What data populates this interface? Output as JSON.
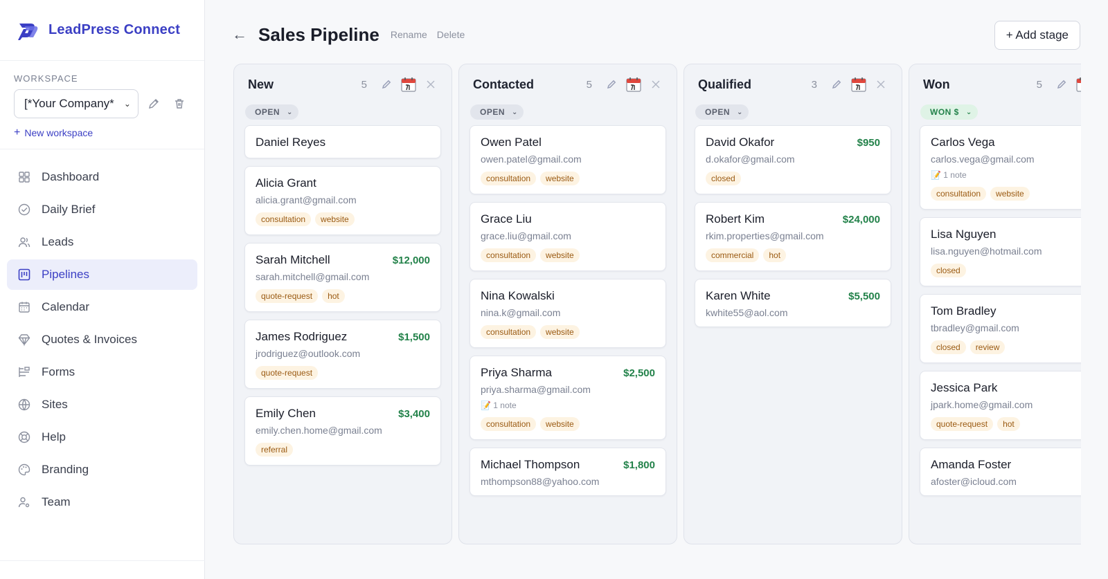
{
  "brand": {
    "name": "LeadPress Connect"
  },
  "workspace": {
    "label": "WORKSPACE",
    "selected": "[*Your Company*",
    "new_label": "New workspace"
  },
  "nav": [
    {
      "label": "Dashboard",
      "icon": "grid-icon",
      "active": false
    },
    {
      "label": "Daily Brief",
      "icon": "check-circle-icon",
      "active": false
    },
    {
      "label": "Leads",
      "icon": "users-icon",
      "active": false
    },
    {
      "label": "Pipelines",
      "icon": "kanban-icon",
      "active": true
    },
    {
      "label": "Calendar",
      "icon": "calendar-icon",
      "active": false
    },
    {
      "label": "Quotes & Invoices",
      "icon": "diamond-icon",
      "active": false
    },
    {
      "label": "Forms",
      "icon": "form-icon",
      "active": false
    },
    {
      "label": "Sites",
      "icon": "globe-icon",
      "active": false
    },
    {
      "label": "Help",
      "icon": "lifebuoy-icon",
      "active": false
    },
    {
      "label": "Branding",
      "icon": "palette-icon",
      "active": false
    },
    {
      "label": "Team",
      "icon": "user-gear-icon",
      "active": false
    }
  ],
  "header": {
    "back": "←",
    "title": "Sales Pipeline",
    "rename": "Rename",
    "delete": "Delete",
    "add_stage": "+ Add stage"
  },
  "columns": [
    {
      "title": "New",
      "count": "5",
      "status": "OPEN",
      "status_type": "open",
      "cards": [
        {
          "name": "Daniel Reyes",
          "amount": "",
          "email": "",
          "note": "",
          "tags": []
        },
        {
          "name": "Alicia Grant",
          "amount": "",
          "email": "alicia.grant@gmail.com",
          "note": "",
          "tags": [
            "consultation",
            "website"
          ]
        },
        {
          "name": "Sarah Mitchell",
          "amount": "$12,000",
          "email": "sarah.mitchell@gmail.com",
          "note": "",
          "tags": [
            "quote-request",
            "hot"
          ]
        },
        {
          "name": "James Rodriguez",
          "amount": "$1,500",
          "email": "jrodriguez@outlook.com",
          "note": "",
          "tags": [
            "quote-request"
          ]
        },
        {
          "name": "Emily Chen",
          "amount": "$3,400",
          "email": "emily.chen.home@gmail.com",
          "note": "",
          "tags": [
            "referral"
          ]
        }
      ]
    },
    {
      "title": "Contacted",
      "count": "5",
      "status": "OPEN",
      "status_type": "open",
      "cards": [
        {
          "name": "Owen Patel",
          "amount": "",
          "email": "owen.patel@gmail.com",
          "note": "",
          "tags": [
            "consultation",
            "website"
          ]
        },
        {
          "name": "Grace Liu",
          "amount": "",
          "email": "grace.liu@gmail.com",
          "note": "",
          "tags": [
            "consultation",
            "website"
          ]
        },
        {
          "name": "Nina Kowalski",
          "amount": "",
          "email": "nina.k@gmail.com",
          "note": "",
          "tags": [
            "consultation",
            "website"
          ]
        },
        {
          "name": "Priya Sharma",
          "amount": "$2,500",
          "email": "priya.sharma@gmail.com",
          "note": "📝 1 note",
          "tags": [
            "consultation",
            "website"
          ]
        },
        {
          "name": "Michael Thompson",
          "amount": "$1,800",
          "email": "mthompson88@yahoo.com",
          "note": "",
          "tags": []
        }
      ]
    },
    {
      "title": "Qualified",
      "count": "3",
      "status": "OPEN",
      "status_type": "open",
      "cards": [
        {
          "name": "David Okafor",
          "amount": "$950",
          "email": "d.okafor@gmail.com",
          "note": "",
          "tags": [
            "closed"
          ]
        },
        {
          "name": "Robert Kim",
          "amount": "$24,000",
          "email": "rkim.properties@gmail.com",
          "note": "",
          "tags": [
            "commercial",
            "hot"
          ]
        },
        {
          "name": "Karen White",
          "amount": "$5,500",
          "email": "kwhite55@aol.com",
          "note": "",
          "tags": []
        }
      ]
    },
    {
      "title": "Won",
      "count": "5",
      "status": "WON $",
      "status_type": "won",
      "cards": [
        {
          "name": "Carlos Vega",
          "amount": "",
          "email": "carlos.vega@gmail.com",
          "note": "📝 1 note",
          "tags": [
            "consultation",
            "website"
          ]
        },
        {
          "name": "Lisa Nguyen",
          "amount": "",
          "email": "lisa.nguyen@hotmail.com",
          "note": "",
          "tags": [
            "closed"
          ]
        },
        {
          "name": "Tom Bradley",
          "amount": "",
          "email": "tbradley@gmail.com",
          "note": "",
          "tags": [
            "closed",
            "review"
          ]
        },
        {
          "name": "Jessica Park",
          "amount": "",
          "email": "jpark.home@gmail.com",
          "note": "",
          "tags": [
            "quote-request",
            "hot"
          ]
        },
        {
          "name": "Amanda Foster",
          "amount": "",
          "email": "afoster@icloud.com",
          "note": "",
          "tags": []
        }
      ]
    }
  ]
}
